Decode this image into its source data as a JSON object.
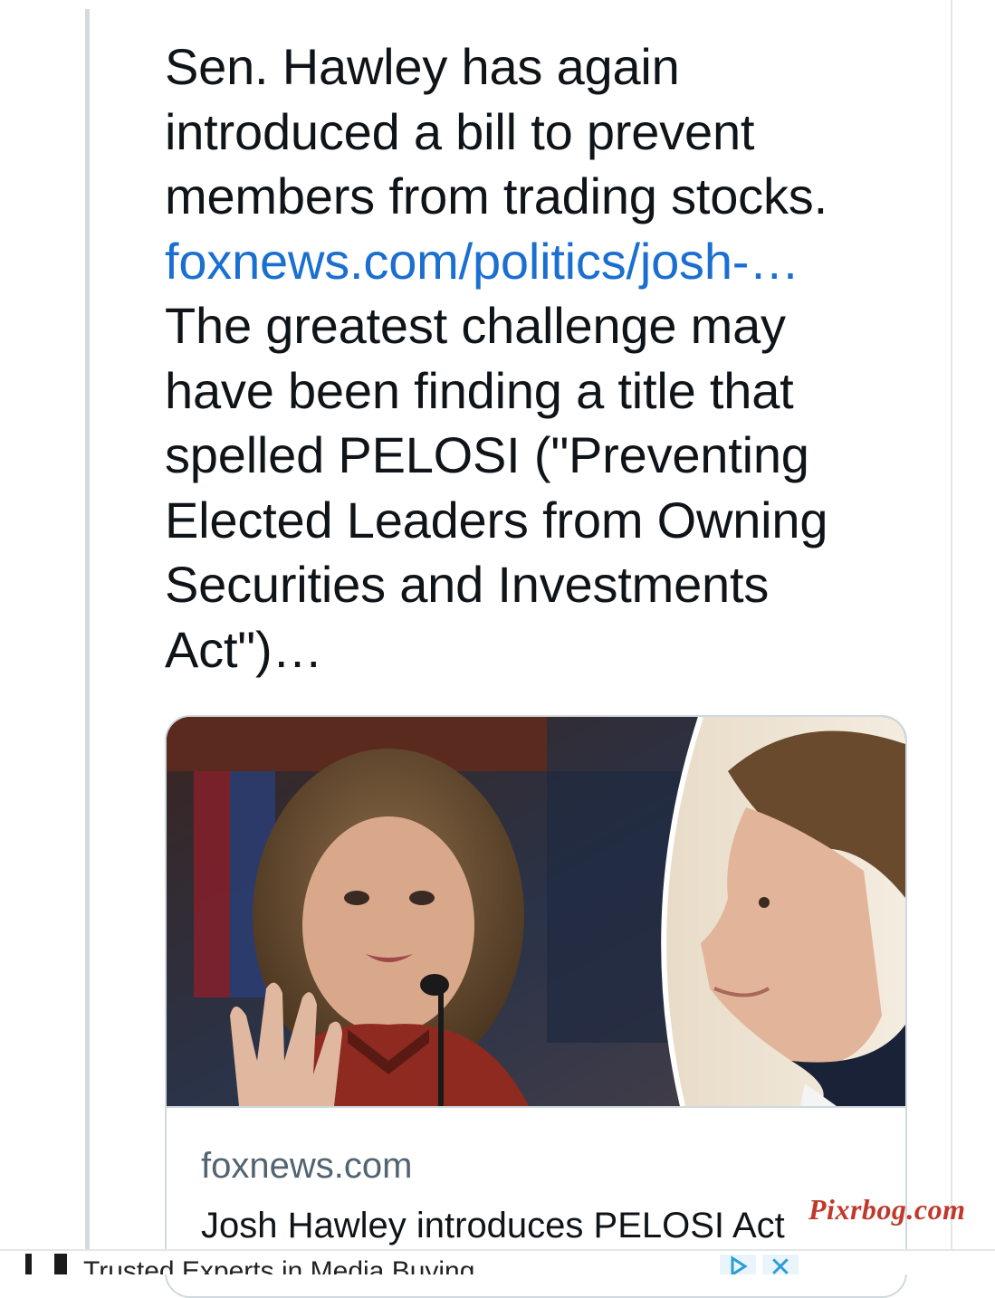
{
  "tweet": {
    "lines": [
      "Sen. Hawley has again",
      "introduced a bill to prevent",
      "members from trading stocks.",
      "foxnews.com/politics/josh-…",
      "The greatest challenge may",
      "have been finding a title that",
      "spelled PELOSI (\"Preventing",
      "Elected Leaders from Owning",
      "Securities and Investments",
      "Act\")…"
    ],
    "link_color": "#1b6fd0"
  },
  "card": {
    "domain": "foxnews.com",
    "title": "Josh Hawley introduces PELOSI Act"
  },
  "watermark": "Pixrbog.com",
  "ad": {
    "text": "Trusted Experts in Media Buying",
    "adchoices_icon": "adchoices-icon",
    "close_icon": "close-icon"
  }
}
